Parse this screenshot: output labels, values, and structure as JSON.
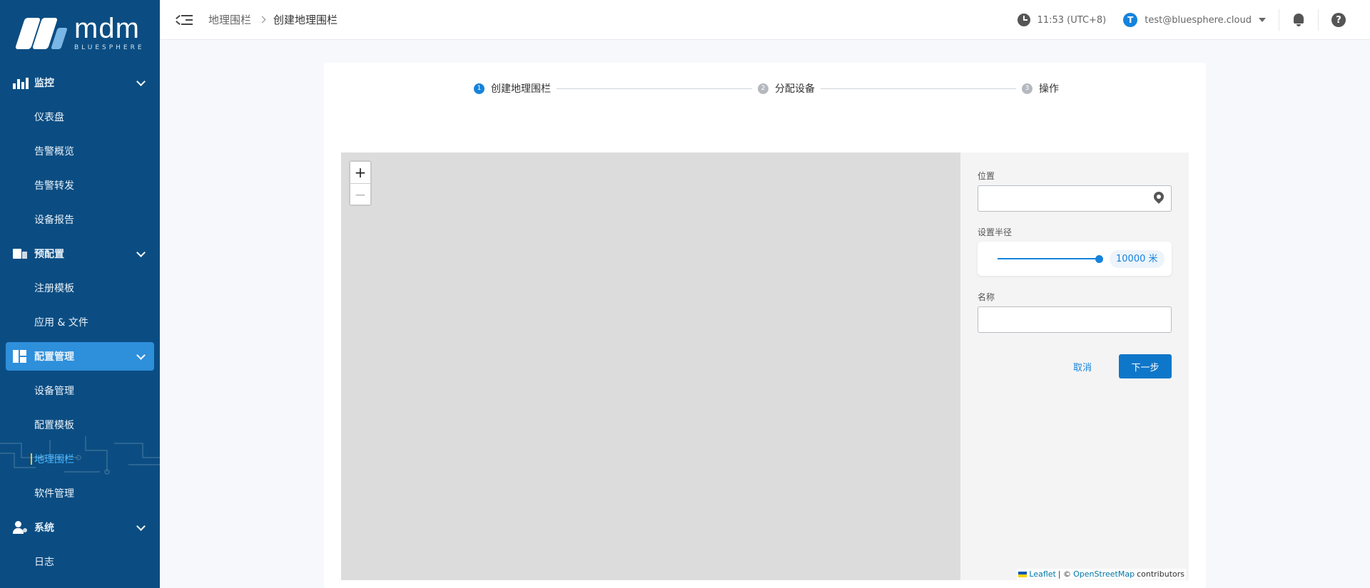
{
  "logo": {
    "brand": "mdm",
    "sub": "BLUESPHERE"
  },
  "sidebar": {
    "groups": [
      {
        "label": "监控",
        "items": [
          "仪表盘",
          "告警概览",
          "告警转发",
          "设备报告"
        ]
      },
      {
        "label": "预配置",
        "items": [
          "注册模板",
          "应用 & 文件"
        ]
      },
      {
        "label": "配置管理",
        "items": [
          "设备管理",
          "配置模板",
          "地理围栏",
          "软件管理"
        ]
      },
      {
        "label": "系统",
        "items": [
          "日志"
        ]
      }
    ],
    "active_group": "配置管理",
    "current_item": "地理围栏"
  },
  "header": {
    "breadcrumb": [
      "地理围栏",
      "创建地理围栏"
    ],
    "time": "11:53 (UTC+8)",
    "user_initial": "T",
    "user_email": "test@bluesphere.cloud"
  },
  "steps": [
    {
      "num": "1",
      "label": "创建地理围栏",
      "active": true
    },
    {
      "num": "2",
      "label": "分配设备",
      "active": false
    },
    {
      "num": "3",
      "label": "操作",
      "active": false
    }
  ],
  "map": {
    "zoom_in": "+",
    "zoom_out": "−",
    "attribution": {
      "leaflet": "Leaflet",
      "sep": "| ©",
      "osm": "OpenStreetMap",
      "suffix": "contributors"
    }
  },
  "form": {
    "location_label": "位置",
    "location_value": "",
    "radius_label": "设置半径",
    "radius_value": "10000 米",
    "name_label": "名称",
    "name_value": "",
    "cancel_label": "取消",
    "next_label": "下一步"
  },
  "colors": {
    "sidebar": "#0b4d82",
    "accent": "#1583dc",
    "active_group": "#2e8fdb",
    "current_item": "#49b6ff"
  }
}
